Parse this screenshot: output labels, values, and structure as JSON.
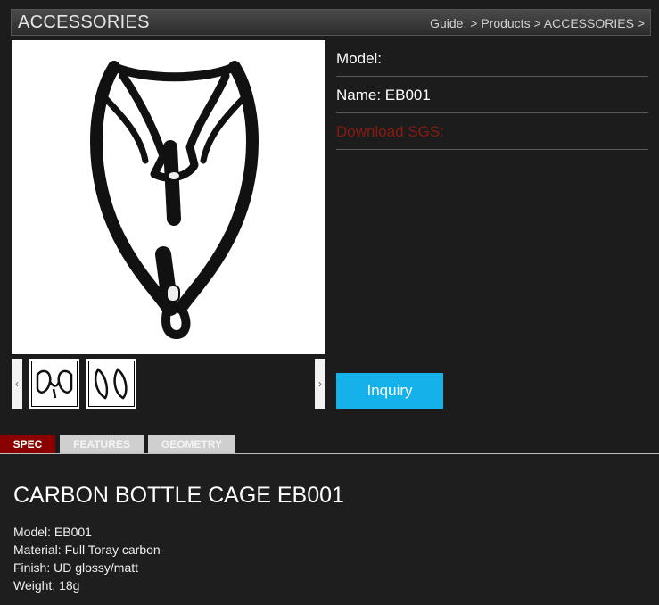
{
  "header": {
    "title": "ACCESSORIES",
    "breadcrumb": [
      "Guide:",
      ">",
      "Products",
      ">",
      "ACCESSORIES",
      ">"
    ]
  },
  "product": {
    "model_label": "Model:",
    "name_label": "Name: EB001",
    "sgs_label": "Download SGS:",
    "inquiry_label": "Inquiry"
  },
  "gallery": {
    "prev_arrow": "‹",
    "next_arrow": "›"
  },
  "tabs": [
    {
      "label": "SPEC",
      "active": true
    },
    {
      "label": "FEATURES",
      "active": false
    },
    {
      "label": "GEOMETRY",
      "active": false
    }
  ],
  "spec": {
    "title": "CARBON BOTTLE CAGE EB001",
    "lines": [
      "Model: EB001",
      "Material: Full Toray carbon",
      "Finish: UD glossy/matt",
      "Weight: 18g"
    ]
  },
  "colors": {
    "active_tab": "#8b0000",
    "inquiry_button": "#14b1ea",
    "sgs_link": "#8a1a12",
    "background": "#1c1c1c"
  }
}
